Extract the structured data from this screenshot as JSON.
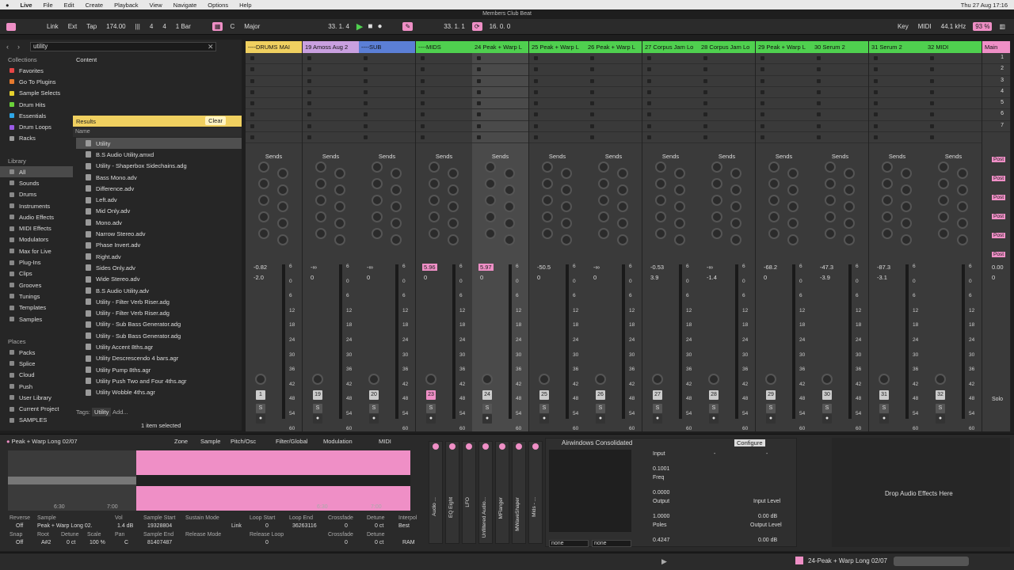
{
  "menubar": {
    "app": "Live",
    "items": [
      "File",
      "Edit",
      "Create",
      "Playback",
      "View",
      "Navigate",
      "Options",
      "Help"
    ],
    "datetime": "Thu 27 Aug  17:16"
  },
  "window_title": "Members Club Beat",
  "transport": {
    "link": "Link",
    "ext": "Ext",
    "tap": "Tap",
    "tempo": "174.00",
    "sig_num": "4",
    "sig_den": "4",
    "quant": "1 Bar",
    "key": "C",
    "scale": "Major",
    "position": "33.  1.  4",
    "loop_start": "33.  1.  1",
    "loop_len": "16.  0.  0",
    "key_label": "Key",
    "midi_label": "MIDI",
    "sample_rate": "44.1 kHz",
    "cpu": "93 %"
  },
  "browser": {
    "search": "utility",
    "content": "Content",
    "collections_title": "Collections",
    "collections": [
      {
        "name": "Favorites",
        "color": "#e64646"
      },
      {
        "name": "Go To Plugins",
        "color": "#e67a2e"
      },
      {
        "name": "Sample Selects",
        "color": "#e6d12e"
      },
      {
        "name": "Drum Hits",
        "color": "#6bd23a"
      },
      {
        "name": "Essentials",
        "color": "#2ea6e6"
      },
      {
        "name": "Drum Loops",
        "color": "#9a5ae6"
      },
      {
        "name": "Racks",
        "color": "#999999"
      }
    ],
    "library_title": "Library",
    "library": [
      "All",
      "Sounds",
      "Drums",
      "Instruments",
      "Audio Effects",
      "MIDI Effects",
      "Modulators",
      "Max for Live",
      "Plug-Ins",
      "Clips",
      "Grooves",
      "Tunings",
      "Templates",
      "Samples"
    ],
    "places_title": "Places",
    "places": [
      "Packs",
      "Splice",
      "Cloud",
      "Push",
      "User Library",
      "Current Project",
      "SAMPLES"
    ],
    "results_label": "Results",
    "clear": "Clear",
    "name_header": "Name",
    "results": [
      "Utility",
      "B.S Audio Utility.amxd",
      "Utility - Shaperbox Sidechains.adg",
      "Bass Mono.adv",
      "Difference.adv",
      "Left.adv",
      "Mid Only.adv",
      "Mono.adv",
      "Narrow Stereo.adv",
      "Phase Invert.adv",
      "Right.adv",
      "Sides Only.adv",
      "Wide Stereo.adv",
      "B.S Audio Utility.adv",
      "Utility - Filter Verb Riser.adg",
      "Utility - Filter Verb Riser.adg",
      "Utility - Sub Bass Generator.adg",
      "Utility - Sub Bass Generator.adg",
      "Utility Accent 8ths.agr",
      "Utility Descrescendo 4 bars.agr",
      "Utility Pump 8ths.agr",
      "Utility Push Two and Four 4ths.agr",
      "Utility Wobble 4ths.agr"
    ],
    "tags": "Tags:",
    "tag1": "Utility",
    "add": "Add...",
    "status": "1 item selected"
  },
  "tracks": [
    {
      "name": "----DRUMS MAI",
      "color": "#f0d060",
      "vol": "-0.82",
      "pan": "-2.0",
      "num": "1"
    },
    {
      "name": "19 Amoss  Aug  2",
      "color": "#c9a0e0",
      "vol": "-∞",
      "pan": "0",
      "num": "19"
    },
    {
      "name": "----SUB",
      "color": "#5b7fd6",
      "vol": "-∞",
      "pan": "0",
      "num": "20"
    },
    {
      "name": "----MIDS",
      "color": "#4fd04f",
      "vol": "5.96",
      "pan": "0",
      "num": "23"
    },
    {
      "name": "24 Peak + Warp L",
      "color": "#4fd04f",
      "vol": "5.97",
      "pan": "0",
      "num": "24"
    },
    {
      "name": "25 Peak + Warp L",
      "color": "#4fd04f",
      "vol": "-50.5",
      "pan": "0",
      "num": "25"
    },
    {
      "name": "26 Peak + Warp L",
      "color": "#4fd04f",
      "vol": "-∞",
      "pan": "0",
      "num": "26"
    },
    {
      "name": "27 Corpus Jam Lo",
      "color": "#4fd04f",
      "vol": "-0.53",
      "pan": "3.9",
      "num": "27"
    },
    {
      "name": "28 Corpus Jam Lo",
      "color": "#4fd04f",
      "vol": "-∞",
      "pan": "-1.4",
      "num": "28"
    },
    {
      "name": "29 Peak + Warp L",
      "color": "#4fd04f",
      "vol": "-68.2",
      "pan": "0",
      "num": "29"
    },
    {
      "name": "30 Serum 2",
      "color": "#4fd04f",
      "vol": "-47.3",
      "pan": "-3.9",
      "num": "30"
    },
    {
      "name": "31 Serum 2",
      "color": "#4fd04f",
      "vol": "-87.3",
      "pan": "-3.1",
      "num": "31"
    },
    {
      "name": "32 MIDI",
      "color": "#4fd04f",
      "vol": "",
      "pan": "",
      "num": "32"
    }
  ],
  "main": {
    "name": "Main",
    "scenes": [
      "1",
      "2",
      "3",
      "4",
      "5",
      "6",
      "7"
    ],
    "vol": "0.00",
    "pan": "0",
    "post": "Post",
    "solo": "Solo"
  },
  "sends_label": "Sends",
  "db_scale": [
    "6",
    "0",
    "6",
    "12",
    "18",
    "24",
    "30",
    "36",
    "42",
    "48",
    "54",
    "60"
  ],
  "clip": {
    "title": "Peak + Warp Long 02/07",
    "tabs": [
      "Zone",
      "Sample",
      "Pitch/Osc",
      "Filter/Global",
      "Modulation",
      "MIDI"
    ],
    "reverse": "Reverse",
    "reverse_val": "Off",
    "sample": "Sample",
    "sample_val": "Peak + Warp Long 02.",
    "vol": "Vol",
    "vol_val": "1.4 dB",
    "sample_start": "Sample Start",
    "sample_start_val": "19328804",
    "sustain": "Sustain Mode",
    "link": "Link",
    "loop_start": "Loop Start",
    "loop_start_val": "0",
    "loop_end": "Loop End",
    "loop_end_val": "36263116",
    "crossfade": "Crossfade",
    "crossfade_val": "0",
    "detune": "Detune",
    "detune_val": "0 ct",
    "interp": "Interpol",
    "interp_val": "Best",
    "snap": "Snap",
    "snap_val": "Off",
    "root": "Root",
    "root_val": "A#2",
    "detune2": "Detune",
    "detune2_val": "0 ct",
    "scale": "Scale",
    "scale_val": "100 %",
    "pan": "Pan",
    "pan_val": "C",
    "sample_end": "Sample End",
    "sample_end_val": "81407487",
    "release": "Release Mode",
    "release_loop": "Release Loop",
    "release_loop_val": "0",
    "crossfade2": "Crossfade",
    "crossfade2_val": "0",
    "detune3": "Detune",
    "detune3_val": "0 ct",
    "ram": "RAM",
    "t1": "6:30",
    "t2": "7:00",
    "t3": "6:30",
    "t4": "7:00"
  },
  "devices": [
    "Audio ...",
    "EQ Eight",
    "LFO",
    "Unfiltered Audio...",
    "MFlanger",
    "MWaveShaper",
    "Mids - ..."
  ],
  "plugin": {
    "title": "Airwindows Consolidated",
    "configure": "Configure",
    "input": "Input",
    "input_val": "0.1001",
    "freq": "Freq",
    "freq_val": "0.0000",
    "output": "Output",
    "output_val": "1.0000",
    "poles": "Poles",
    "poles_val": "0.4247",
    "input_level": "Input Level",
    "input_level_val": "0.00 dB",
    "output_level": "Output Level",
    "output_level_val": "0.00 dB",
    "dash": "-",
    "none1": "none",
    "none2": "none"
  },
  "drop_text": "Drop Audio Effects Here",
  "status_clip": "24-Peak + Warp Long 02/07",
  "colors": {
    "accent": "#ef8fc6",
    "green": "#4fd04f",
    "orange": "#f0a000"
  }
}
